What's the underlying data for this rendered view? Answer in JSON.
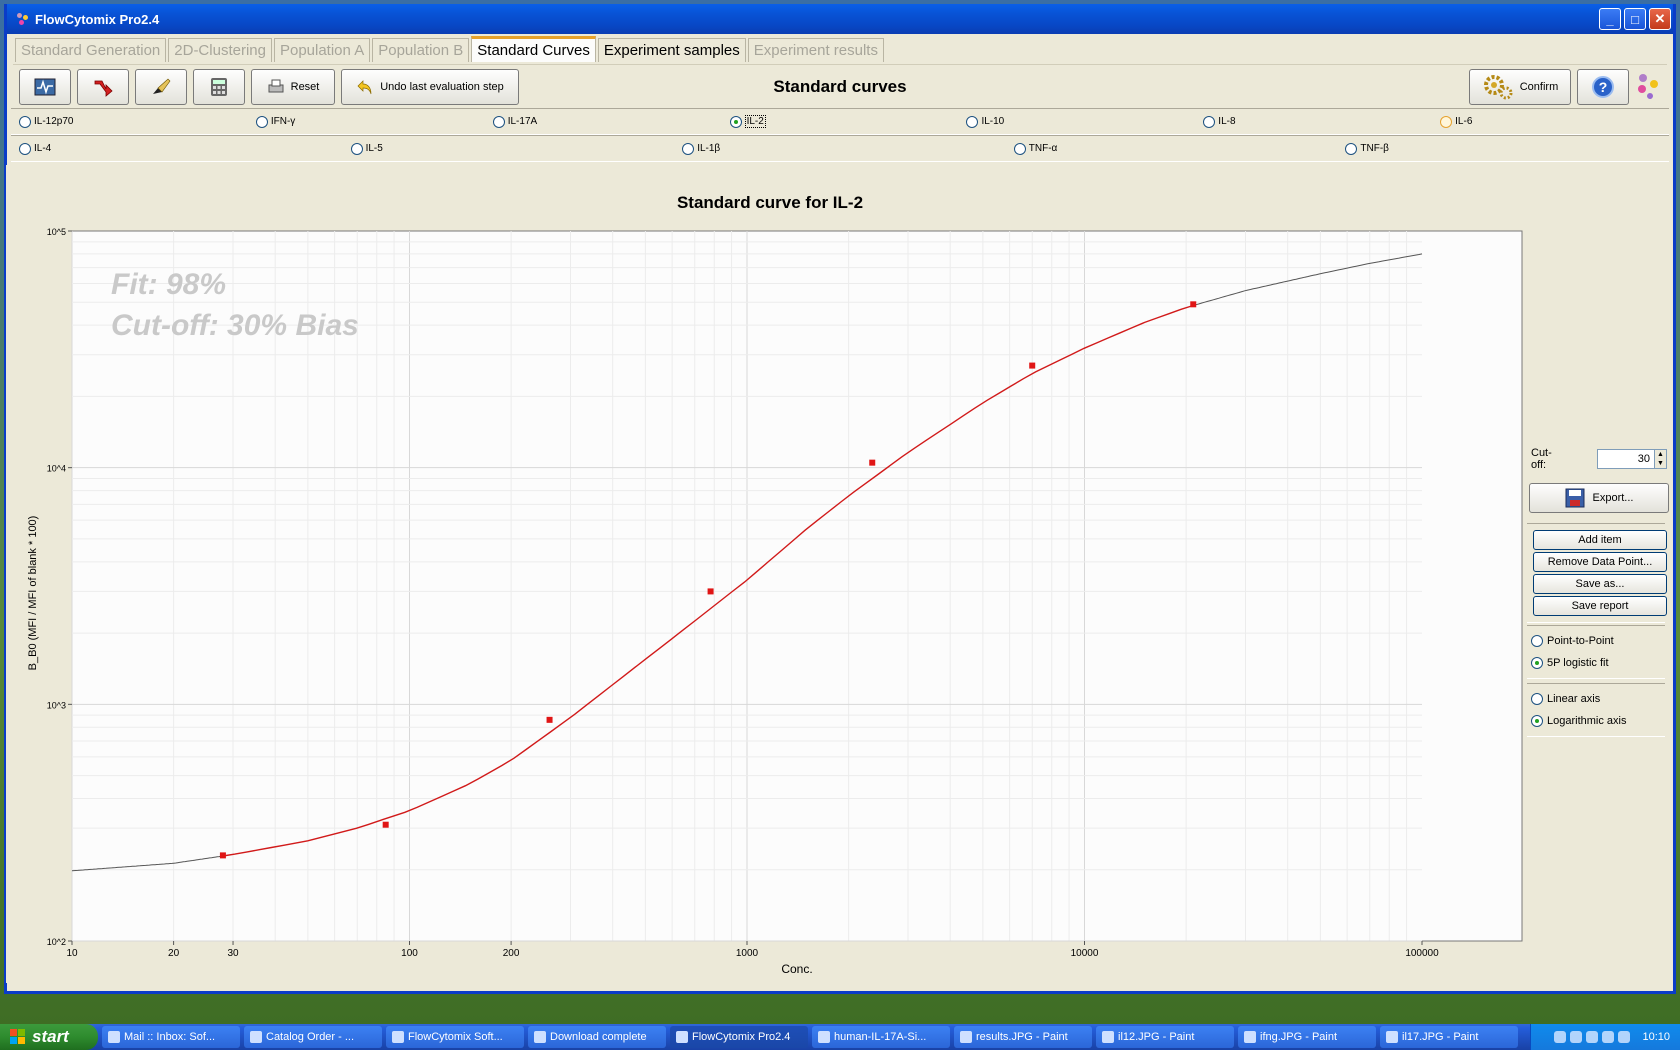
{
  "window": {
    "title": "FlowCytomix Pro2.4",
    "controls": [
      "_",
      "□",
      "✕"
    ]
  },
  "tabs": [
    {
      "label": "Standard Generation",
      "state": "disabled"
    },
    {
      "label": "2D-Clustering",
      "state": "disabled"
    },
    {
      "label": "Population A",
      "state": "disabled"
    },
    {
      "label": "Population B",
      "state": "disabled"
    },
    {
      "label": "Standard Curves",
      "state": "active"
    },
    {
      "label": "Experiment samples",
      "state": "normal"
    },
    {
      "label": "Experiment results",
      "state": "disabled"
    }
  ],
  "toolbar": {
    "title": "Standard curves",
    "reset_label": "Reset",
    "undo_label": "Undo last evaluation step",
    "confirm_label": "Confirm",
    "help_label": "?"
  },
  "analytes_row1": [
    {
      "label": "IL-12p70",
      "selected": false
    },
    {
      "label": "IFN-γ",
      "selected": false
    },
    {
      "label": "IL-17A",
      "selected": false
    },
    {
      "label": "IL-2",
      "selected": true
    },
    {
      "label": "IL-10",
      "selected": false
    },
    {
      "label": "IL-8",
      "selected": false
    },
    {
      "label": "IL-6",
      "selected": false
    }
  ],
  "analytes_row2": [
    {
      "label": "IL-4",
      "selected": false
    },
    {
      "label": "IL-5",
      "selected": false
    },
    {
      "label": "IL-1β",
      "selected": false
    },
    {
      "label": "TNF-α",
      "selected": false
    },
    {
      "label": "TNF-β",
      "selected": false
    }
  ],
  "chart_data": {
    "type": "scatter",
    "title": "Standard curve for  IL-2",
    "xlabel": "Conc.",
    "ylabel": "B_B0 (MFI / MFI of blank * 100)",
    "x_scale": "log",
    "y_scale": "log",
    "xlim": [
      10,
      100000
    ],
    "ylim": [
      100,
      100000
    ],
    "x_tick_labels": [
      "10",
      "20",
      "30",
      "100",
      "200",
      "1000",
      "10000",
      "100000"
    ],
    "y_tick_labels": [
      "10^5",
      "10^4",
      "10^3",
      "10^2"
    ],
    "grid": true,
    "annotations": [
      "Fit: 98%",
      "Cut-off: 30% Bias"
    ],
    "points": [
      {
        "x": 28,
        "y": 230
      },
      {
        "x": 85,
        "y": 310
      },
      {
        "x": 260,
        "y": 860
      },
      {
        "x": 780,
        "y": 3000
      },
      {
        "x": 2350,
        "y": 10500
      },
      {
        "x": 7000,
        "y": 27000
      },
      {
        "x": 21000,
        "y": 49000
      }
    ],
    "fit_curve": {
      "name": "5P logistic fit",
      "x": [
        10,
        20,
        30,
        50,
        70,
        100,
        150,
        200,
        300,
        500,
        700,
        1000,
        1500,
        2000,
        3000,
        5000,
        7000,
        10000,
        15000,
        20000,
        30000,
        50000,
        70000,
        100000
      ],
      "y": [
        198,
        213,
        232,
        265,
        300,
        355,
        460,
        580,
        880,
        1550,
        2250,
        3350,
        5500,
        7600,
        11600,
        18800,
        25000,
        32000,
        41000,
        47500,
        56000,
        66000,
        73000,
        80000
      ]
    },
    "colors": {
      "points": "#e01515",
      "fit": "#d11a1a",
      "extrapolated": "#555555"
    }
  },
  "side": {
    "cutoff_label": "Cut-off:",
    "cutoff_value": "30",
    "export_label": "Export...",
    "buttons": [
      "Add item",
      "Remove Data Point...",
      "Save as...",
      "Save report"
    ],
    "fit_options": [
      {
        "label": "Point-to-Point",
        "selected": false
      },
      {
        "label": "5P logistic fit",
        "selected": true
      }
    ],
    "axis_options": [
      {
        "label": "Linear axis",
        "selected": false
      },
      {
        "label": "Logarithmic axis",
        "selected": true
      }
    ]
  },
  "taskbar": {
    "start_label": "start",
    "items": [
      {
        "label": "Mail :: Inbox: Sof...",
        "active": false
      },
      {
        "label": "Catalog Order - ...",
        "active": false
      },
      {
        "label": "FlowCytomix Soft...",
        "active": false
      },
      {
        "label": "Download complete",
        "active": false
      },
      {
        "label": "FlowCytomix Pro2.4",
        "active": true
      },
      {
        "label": "human-IL-17A-Si...",
        "active": false
      },
      {
        "label": "results.JPG - Paint",
        "active": false
      },
      {
        "label": "il12.JPG - Paint",
        "active": false
      },
      {
        "label": "ifng.JPG - Paint",
        "active": false
      },
      {
        "label": "il17.JPG - Paint",
        "active": false
      }
    ],
    "clock": "10:10"
  }
}
